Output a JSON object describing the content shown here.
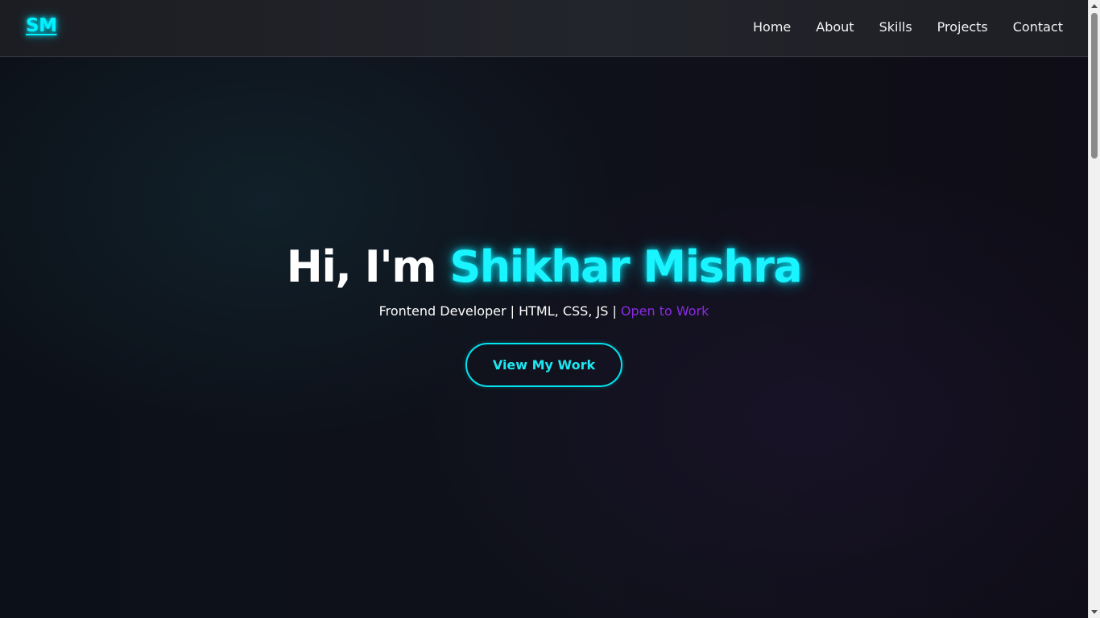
{
  "navbar": {
    "logo": "SM",
    "links": [
      "Home",
      "About",
      "Skills",
      "Projects",
      "Contact"
    ]
  },
  "hero": {
    "greeting": "Hi, I'm ",
    "name": "Shikhar Mishra",
    "subtitle_prefix": "Frontend Developer | HTML, CSS, JS | ",
    "subtitle_accent": "Open to Work",
    "cta_label": "View My Work"
  },
  "colors": {
    "accent_cyan": "#00f2ff",
    "accent_purple": "#8a2be2",
    "background": "#0d0e16",
    "navbar": "#23252c"
  },
  "icons": {
    "scroll_up": "chevron-up-icon",
    "scroll_down": "chevron-down-icon"
  }
}
